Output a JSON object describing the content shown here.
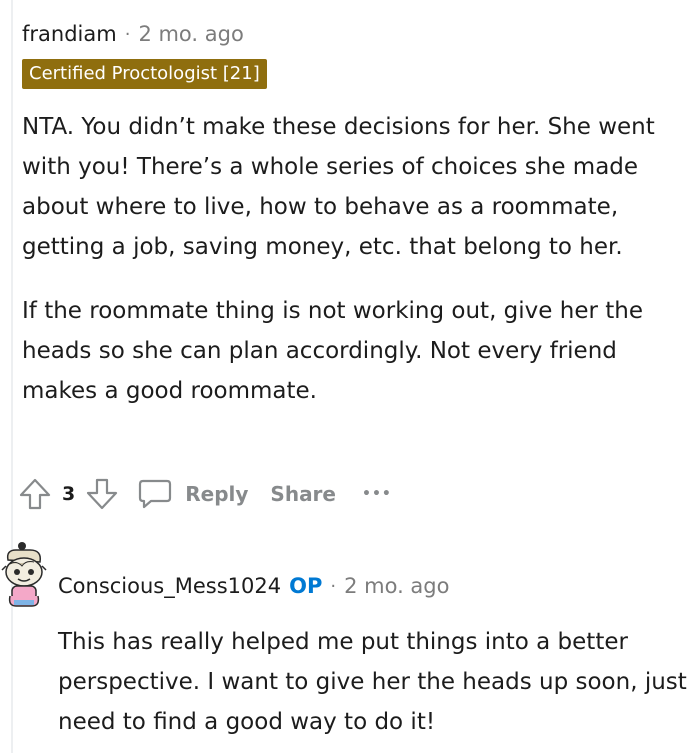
{
  "comment1": {
    "username": "frandiam",
    "separator": "·",
    "time": "2 mo. ago",
    "flair": "Certified Proctologist [21]",
    "paragraphs": [
      "NTA. You didn’t make these decisions for her. She went with you! There’s a whole series of choices she made about where to live, how to behave as a roommate, getting a job, saving money, etc. that belong to her.",
      "If the roommate thing is not working out, give her the heads so she can plan accordingly. Not every friend makes a good roommate."
    ],
    "actions": {
      "upvote_icon": "arrow-up-icon",
      "vote_count": "3",
      "downvote_icon": "arrow-down-icon",
      "reply_icon": "speech-bubble-icon",
      "reply_label": "Reply",
      "share_label": "Share",
      "more_icon": "ellipsis-icon",
      "more_label": "•••"
    }
  },
  "comment2": {
    "username": "Conscious_Mess1024",
    "op_badge": "OP",
    "separator": "·",
    "time": "2 mo. ago",
    "avatar_icon": "snoo-avatar",
    "paragraphs": [
      "This has really helped me put things into a better perspective. I want to give her the heads up soon, just need to find a good way to do it!"
    ]
  },
  "colors": {
    "flair_background": "#8f6e0e",
    "op_badge": "#0079d3",
    "muted_text": "#7c7c7c",
    "action_gray": "#878a8c"
  }
}
